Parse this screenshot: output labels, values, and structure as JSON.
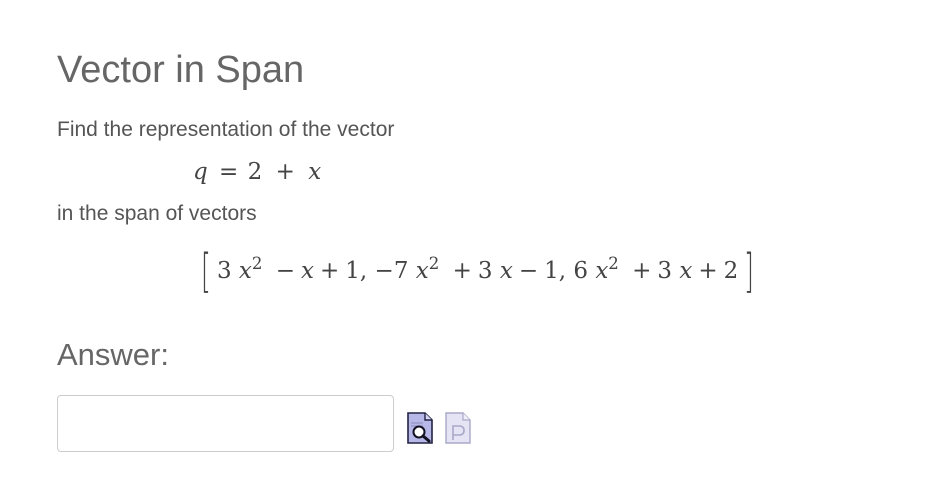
{
  "problem": {
    "title": "Vector in Span",
    "prompt_find": "Find the representation of the vector",
    "prompt_span": "in the span of vectors",
    "vector_q": {
      "lhs": "q",
      "eq": "=",
      "terms": [
        "2",
        "+",
        "x"
      ]
    },
    "span_vectors": {
      "open": "[",
      "close": "]",
      "v1": {
        "coef_a": "3",
        "var": "x",
        "exp": "2",
        "rest": [
          "−",
          "x",
          "+",
          "1,"
        ]
      },
      "v2": {
        "coef_a": "−7",
        "var": "x",
        "exp": "2",
        "rest": [
          "+",
          "3",
          "x",
          "−",
          "1,"
        ]
      },
      "v3": {
        "coef_a": "6",
        "var": "x",
        "exp": "2",
        "rest": [
          "+",
          "3",
          "x",
          "+",
          "2"
        ]
      }
    }
  },
  "answer": {
    "label": "Answer:",
    "value": "",
    "placeholder": ""
  },
  "icons": {
    "preview": "preview-magnifier-icon",
    "pgml": "pgml-help-icon",
    "preview_color": "#b8b8e8",
    "pgml_color": "#e4e4f4"
  }
}
